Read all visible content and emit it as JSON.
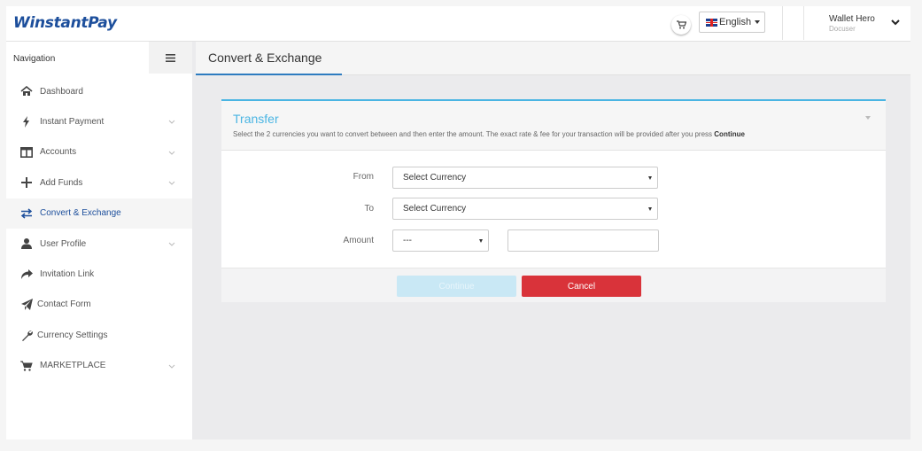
{
  "app": {
    "logo": "WinstantPay"
  },
  "header": {
    "language": "English",
    "user_name": "Wallet Hero",
    "user_role": "Docuser"
  },
  "sidebar": {
    "title": "Navigation",
    "items": [
      {
        "label": "Dashboard",
        "icon": "home-icon",
        "expandable": false,
        "active": false
      },
      {
        "label": "Instant Payment",
        "icon": "bolt-icon",
        "expandable": true,
        "active": false
      },
      {
        "label": "Accounts",
        "icon": "columns-icon",
        "expandable": true,
        "active": false
      },
      {
        "label": "Add Funds",
        "icon": "plus-icon",
        "expandable": true,
        "active": false
      },
      {
        "label": "Convert & Exchange",
        "icon": "exchange-icon",
        "expandable": false,
        "active": true
      },
      {
        "label": "User Profile",
        "icon": "user-icon",
        "expandable": true,
        "active": false
      },
      {
        "label": "Invitation Link",
        "icon": "share-icon",
        "expandable": false,
        "active": false
      },
      {
        "label": "Contact Form",
        "icon": "paper-plane-icon",
        "expandable": false,
        "active": false
      },
      {
        "label": "Currency Settings",
        "icon": "wrench-icon",
        "expandable": false,
        "active": false
      },
      {
        "label": "MARKETPLACE",
        "icon": "cart-icon",
        "expandable": true,
        "active": false
      }
    ]
  },
  "page": {
    "title": "Convert & Exchange"
  },
  "transfer": {
    "title": "Transfer",
    "description": "Select the 2 currencies you want to convert between and then enter the amount. The exact rate & fee for your transaction will be provided after you press ",
    "description_bold": "Continue",
    "from_label": "From",
    "from_value": "Select Currency",
    "to_label": "To",
    "to_value": "Select Currency",
    "amount_label": "Amount",
    "amount_currency": "---",
    "amount_value": "",
    "continue_label": "Continue",
    "cancel_label": "Cancel"
  },
  "colors": {
    "brand": "#1d4f9c",
    "accent": "#4ab5e3",
    "tab_underline": "#2e7cc0",
    "cancel": "#d9333a",
    "continue_disabled": "#c9e8f5"
  }
}
